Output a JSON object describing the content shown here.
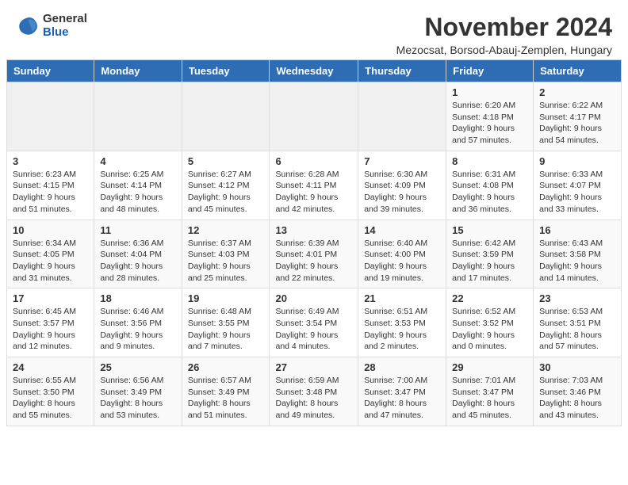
{
  "logo": {
    "general": "General",
    "blue": "Blue"
  },
  "title": "November 2024",
  "subtitle": "Mezocsat, Borsod-Abauj-Zemplen, Hungary",
  "headers": [
    "Sunday",
    "Monday",
    "Tuesday",
    "Wednesday",
    "Thursday",
    "Friday",
    "Saturday"
  ],
  "weeks": [
    [
      {
        "day": "",
        "info": ""
      },
      {
        "day": "",
        "info": ""
      },
      {
        "day": "",
        "info": ""
      },
      {
        "day": "",
        "info": ""
      },
      {
        "day": "",
        "info": ""
      },
      {
        "day": "1",
        "info": "Sunrise: 6:20 AM\nSunset: 4:18 PM\nDaylight: 9 hours and 57 minutes."
      },
      {
        "day": "2",
        "info": "Sunrise: 6:22 AM\nSunset: 4:17 PM\nDaylight: 9 hours and 54 minutes."
      }
    ],
    [
      {
        "day": "3",
        "info": "Sunrise: 6:23 AM\nSunset: 4:15 PM\nDaylight: 9 hours and 51 minutes."
      },
      {
        "day": "4",
        "info": "Sunrise: 6:25 AM\nSunset: 4:14 PM\nDaylight: 9 hours and 48 minutes."
      },
      {
        "day": "5",
        "info": "Sunrise: 6:27 AM\nSunset: 4:12 PM\nDaylight: 9 hours and 45 minutes."
      },
      {
        "day": "6",
        "info": "Sunrise: 6:28 AM\nSunset: 4:11 PM\nDaylight: 9 hours and 42 minutes."
      },
      {
        "day": "7",
        "info": "Sunrise: 6:30 AM\nSunset: 4:09 PM\nDaylight: 9 hours and 39 minutes."
      },
      {
        "day": "8",
        "info": "Sunrise: 6:31 AM\nSunset: 4:08 PM\nDaylight: 9 hours and 36 minutes."
      },
      {
        "day": "9",
        "info": "Sunrise: 6:33 AM\nSunset: 4:07 PM\nDaylight: 9 hours and 33 minutes."
      }
    ],
    [
      {
        "day": "10",
        "info": "Sunrise: 6:34 AM\nSunset: 4:05 PM\nDaylight: 9 hours and 31 minutes."
      },
      {
        "day": "11",
        "info": "Sunrise: 6:36 AM\nSunset: 4:04 PM\nDaylight: 9 hours and 28 minutes."
      },
      {
        "day": "12",
        "info": "Sunrise: 6:37 AM\nSunset: 4:03 PM\nDaylight: 9 hours and 25 minutes."
      },
      {
        "day": "13",
        "info": "Sunrise: 6:39 AM\nSunset: 4:01 PM\nDaylight: 9 hours and 22 minutes."
      },
      {
        "day": "14",
        "info": "Sunrise: 6:40 AM\nSunset: 4:00 PM\nDaylight: 9 hours and 19 minutes."
      },
      {
        "day": "15",
        "info": "Sunrise: 6:42 AM\nSunset: 3:59 PM\nDaylight: 9 hours and 17 minutes."
      },
      {
        "day": "16",
        "info": "Sunrise: 6:43 AM\nSunset: 3:58 PM\nDaylight: 9 hours and 14 minutes."
      }
    ],
    [
      {
        "day": "17",
        "info": "Sunrise: 6:45 AM\nSunset: 3:57 PM\nDaylight: 9 hours and 12 minutes."
      },
      {
        "day": "18",
        "info": "Sunrise: 6:46 AM\nSunset: 3:56 PM\nDaylight: 9 hours and 9 minutes."
      },
      {
        "day": "19",
        "info": "Sunrise: 6:48 AM\nSunset: 3:55 PM\nDaylight: 9 hours and 7 minutes."
      },
      {
        "day": "20",
        "info": "Sunrise: 6:49 AM\nSunset: 3:54 PM\nDaylight: 9 hours and 4 minutes."
      },
      {
        "day": "21",
        "info": "Sunrise: 6:51 AM\nSunset: 3:53 PM\nDaylight: 9 hours and 2 minutes."
      },
      {
        "day": "22",
        "info": "Sunrise: 6:52 AM\nSunset: 3:52 PM\nDaylight: 9 hours and 0 minutes."
      },
      {
        "day": "23",
        "info": "Sunrise: 6:53 AM\nSunset: 3:51 PM\nDaylight: 8 hours and 57 minutes."
      }
    ],
    [
      {
        "day": "24",
        "info": "Sunrise: 6:55 AM\nSunset: 3:50 PM\nDaylight: 8 hours and 55 minutes."
      },
      {
        "day": "25",
        "info": "Sunrise: 6:56 AM\nSunset: 3:49 PM\nDaylight: 8 hours and 53 minutes."
      },
      {
        "day": "26",
        "info": "Sunrise: 6:57 AM\nSunset: 3:49 PM\nDaylight: 8 hours and 51 minutes."
      },
      {
        "day": "27",
        "info": "Sunrise: 6:59 AM\nSunset: 3:48 PM\nDaylight: 8 hours and 49 minutes."
      },
      {
        "day": "28",
        "info": "Sunrise: 7:00 AM\nSunset: 3:47 PM\nDaylight: 8 hours and 47 minutes."
      },
      {
        "day": "29",
        "info": "Sunrise: 7:01 AM\nSunset: 3:47 PM\nDaylight: 8 hours and 45 minutes."
      },
      {
        "day": "30",
        "info": "Sunrise: 7:03 AM\nSunset: 3:46 PM\nDaylight: 8 hours and 43 minutes."
      }
    ]
  ]
}
